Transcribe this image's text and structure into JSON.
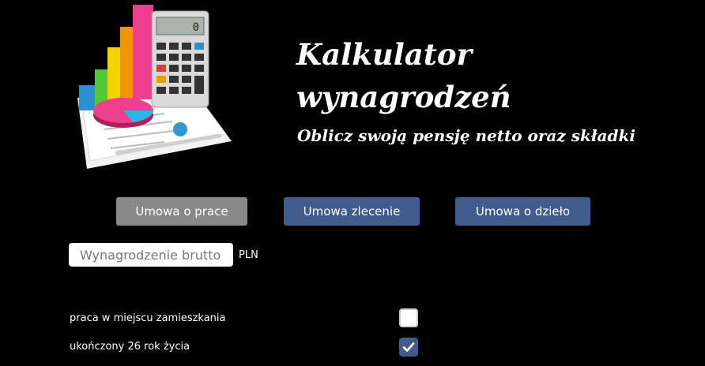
{
  "header": {
    "title": "Kalkulator wynagrodzeń",
    "subtitle": "Oblicz swoją pensję netto oraz składki",
    "image_icon": "calculator-charts-illustration",
    "calculator_display": "0"
  },
  "tabs": [
    {
      "label": "Umowa o prace",
      "active": true
    },
    {
      "label": "Umowa zlecenie",
      "active": false
    },
    {
      "label": "Umowa o dzieło",
      "active": false
    }
  ],
  "salary": {
    "placeholder": "Wynagrodzenie brutto",
    "value": "",
    "currency": "PLN"
  },
  "options": [
    {
      "label": "praca w miejscu zamieszkania",
      "checked": false
    },
    {
      "label": "ukończony 26 rok życia",
      "checked": true
    }
  ],
  "colors": {
    "background": "#000000",
    "tab_active": "#888888",
    "tab_inactive": "#405c8c",
    "checkbox_checked": "#405c8c"
  }
}
